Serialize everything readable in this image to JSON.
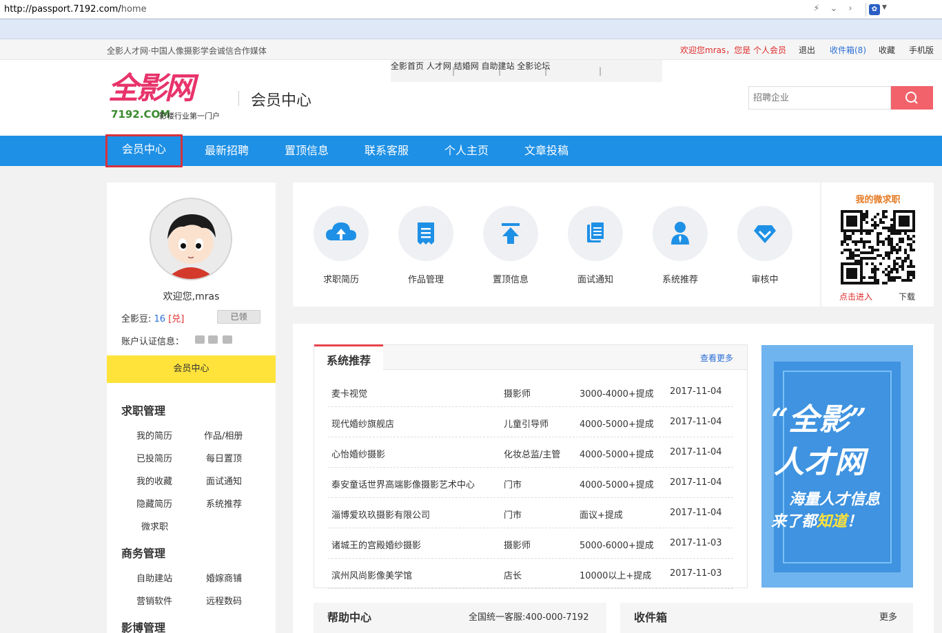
{
  "browser": {
    "url_host": "http://passport.7192.com/",
    "url_path": "home"
  },
  "topbar": {
    "slogan": "全影人才网·中国人像摄影学会诚信合作媒体",
    "welcome": "欢迎您mras，您是 个人会员",
    "logout": "退出",
    "inbox": "收件箱(8)",
    "favorite": "收藏",
    "mobile": "手机版"
  },
  "header": {
    "logo_text": "全影网",
    "logo_domain": "7192.COM",
    "logo_tagline": "影楼行业第一门户",
    "title": "会员中心",
    "subnav": [
      "全影首页",
      "人才网",
      "结婚网",
      "自助建站",
      "全影论坛"
    ],
    "search_placeholder": "招聘企业"
  },
  "mainnav": [
    "会员中心",
    "最新招聘",
    "置顶信息",
    "联系客服",
    "个人主页",
    "文章投稿"
  ],
  "profile": {
    "welcome": "欢迎您,mras",
    "beans_label": "全影豆:",
    "beans_value": "16",
    "beans_redeem": "[兑]",
    "claimed": "已领",
    "verify_label": "账户认证信息："
  },
  "sidebar": {
    "member_center": "会员中心",
    "sections": [
      {
        "title": "求职管理",
        "items": [
          "我的简历",
          "作品/相册",
          "已投简历",
          "每日置顶",
          "我的收藏",
          "面试通知",
          "隐藏简历",
          "系统推荐",
          "微求职"
        ]
      },
      {
        "title": "商务管理",
        "items": [
          "自助建站",
          "婚嫁商铺",
          "营销软件",
          "远程数码"
        ]
      },
      {
        "title": "影博管理",
        "items": []
      }
    ]
  },
  "quick_icons": [
    {
      "label": "求职简历",
      "icon": "cloud-upload-icon"
    },
    {
      "label": "作品管理",
      "icon": "document-icon"
    },
    {
      "label": "置顶信息",
      "icon": "pin-top-icon"
    },
    {
      "label": "面试通知",
      "icon": "notice-icon"
    },
    {
      "label": "系统推荐",
      "icon": "user-icon"
    },
    {
      "label": "审核中",
      "icon": "diamond-icon"
    }
  ],
  "wechat": {
    "title": "我的微求职",
    "enter": "点击进入",
    "download": "下载"
  },
  "recommend": {
    "title": "系统推荐",
    "more": "查看更多",
    "rows": [
      {
        "company": "麦卡视觉",
        "position": "摄影师",
        "salary": "3000-4000+提成",
        "date": "2017-11-04"
      },
      {
        "company": "现代婚纱旗舰店",
        "position": "儿童引导师",
        "salary": "4000-5000+提成",
        "date": "2017-11-04"
      },
      {
        "company": "心怡婚纱摄影",
        "position": "化妆总监/主管",
        "salary": "4000-5000+提成",
        "date": "2017-11-04"
      },
      {
        "company": "泰安童话世界高端影像摄影艺术中心",
        "position": "门市",
        "salary": "4000-5000+提成",
        "date": "2017-11-04"
      },
      {
        "company": "淄博爱玖玖摄影有限公司",
        "position": "门市",
        "salary": "面议+提成",
        "date": "2017-11-04"
      },
      {
        "company": "诸城王的宫殿婚纱摄影",
        "position": "摄影师",
        "salary": "5000-6000+提成",
        "date": "2017-11-03"
      },
      {
        "company": "滨州风尚影像美学馆",
        "position": "店长",
        "salary": "10000以上+提成",
        "date": "2017-11-03"
      }
    ]
  },
  "banner": {
    "line1": "“全影”",
    "line2": "人才网",
    "line3": "海量人才信息",
    "line4_a": "来了都",
    "line4_b": "知道",
    "line4_c": "！"
  },
  "help": {
    "title": "帮助中心",
    "phone": "全国统一客服:400-000-7192"
  },
  "inbox_panel": {
    "title": "收件箱",
    "more": "更多"
  },
  "colors": {
    "nav_blue": "#1e90e6",
    "brand_pink": "#e8336b",
    "yellow": "#ffe33b",
    "icon_blue": "#1e90e6"
  }
}
